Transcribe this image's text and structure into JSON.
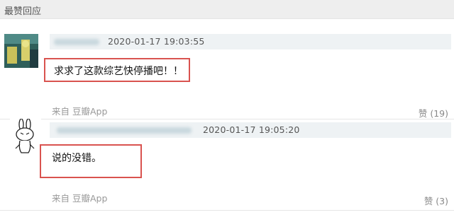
{
  "header": {
    "title": "最赞回应"
  },
  "comments": [
    {
      "timestamp": "2020-01-17 19:03:55",
      "text": "求求了这款综艺快停播吧！！",
      "source": "来自 豆瓣App",
      "likes": "赞 (19)"
    },
    {
      "timestamp": "2020-01-17 19:05:20",
      "text": "说的没错。",
      "source": "来自 豆瓣App",
      "likes": "赞 (3)"
    }
  ]
}
